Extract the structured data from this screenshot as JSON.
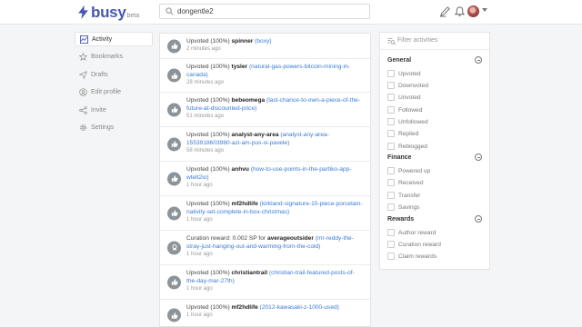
{
  "app": {
    "logo_text": "busy",
    "logo_badge": "beta"
  },
  "search": {
    "value": "dongentle2"
  },
  "nav": [
    {
      "label": "Activity",
      "icon": "activity-icon",
      "active": true
    },
    {
      "label": "Bookmarks",
      "icon": "star-icon"
    },
    {
      "label": "Drafts",
      "icon": "send-icon"
    },
    {
      "label": "Edit profile",
      "icon": "user-icon"
    },
    {
      "label": "Invite",
      "icon": "share-icon"
    },
    {
      "label": "Settings",
      "icon": "gear-icon"
    }
  ],
  "feed": [
    {
      "type": "upvote",
      "prefix": "Upvoted (100%)",
      "user": "spinner",
      "link": "(boxy)",
      "time": "2 minutes ago"
    },
    {
      "type": "upvote",
      "prefix": "Upvoted (100%)",
      "user": "tysler",
      "link": "(natural-gas-powers-bitcoin-mining-in-canada)",
      "time": "28 minutes ago"
    },
    {
      "type": "upvote",
      "prefix": "Upvoted (100%)",
      "user": "bebeomega",
      "link": "(last-chance-to-own-a-piece-of-the-future-at-discounted-price)",
      "time": "51 minutes ago"
    },
    {
      "type": "upvote",
      "prefix": "Upvoted (100%)",
      "user": "analyst-any-area",
      "link": "(analyst-any-area-1553918603980-azi-am-pus-si-pavele)",
      "time": "58 minutes ago"
    },
    {
      "type": "upvote",
      "prefix": "Upvoted (100%)",
      "user": "anhvu",
      "link": "(how-to-use-points-in-the-partiko-app-wtelt2io)",
      "time": "1 hour ago"
    },
    {
      "type": "upvote",
      "prefix": "Upvoted (100%)",
      "user": "mf2hdlife",
      "link": "(kirkland-signature-10-piece-porcelain-nativity-set-complete-in-box-christmas)",
      "time": "1 hour ago"
    },
    {
      "type": "curation",
      "prefix": "Curation reward: 0.002 SP for",
      "user": "averageoutsider",
      "link": "(mr-reddy-the-stray-just-hanging-out-and-warming-from-the-cold)",
      "time": "1 hour ago"
    },
    {
      "type": "upvote",
      "prefix": "Upvoted (100%)",
      "user": "christiantrail",
      "link": "(christian-trail-featured-posts-of-the-day-mar-27th)",
      "time": "1 hour ago"
    },
    {
      "type": "upvote",
      "prefix": "Upvoted (100%)",
      "user": "mf2hdlife",
      "link": "(2012-kawasaki-z-1000-used)",
      "time": "1 hour ago"
    }
  ],
  "filters": {
    "placeholder": "Filter activities",
    "groups": [
      {
        "title": "General",
        "options": [
          "Upvoted",
          "Downvoted",
          "Unvoted",
          "Followed",
          "Unfollowed",
          "Replied",
          "Reblogged"
        ]
      },
      {
        "title": "Finance",
        "options": [
          "Powered up",
          "Received",
          "Transfer",
          "Savings"
        ]
      },
      {
        "title": "Rewards",
        "options": [
          "Author reward",
          "Curation reward",
          "Claim rewards"
        ]
      }
    ]
  },
  "colors": {
    "brand": "#4757b2",
    "link": "#3a7bd5",
    "icon_bg": "#8c9499"
  }
}
